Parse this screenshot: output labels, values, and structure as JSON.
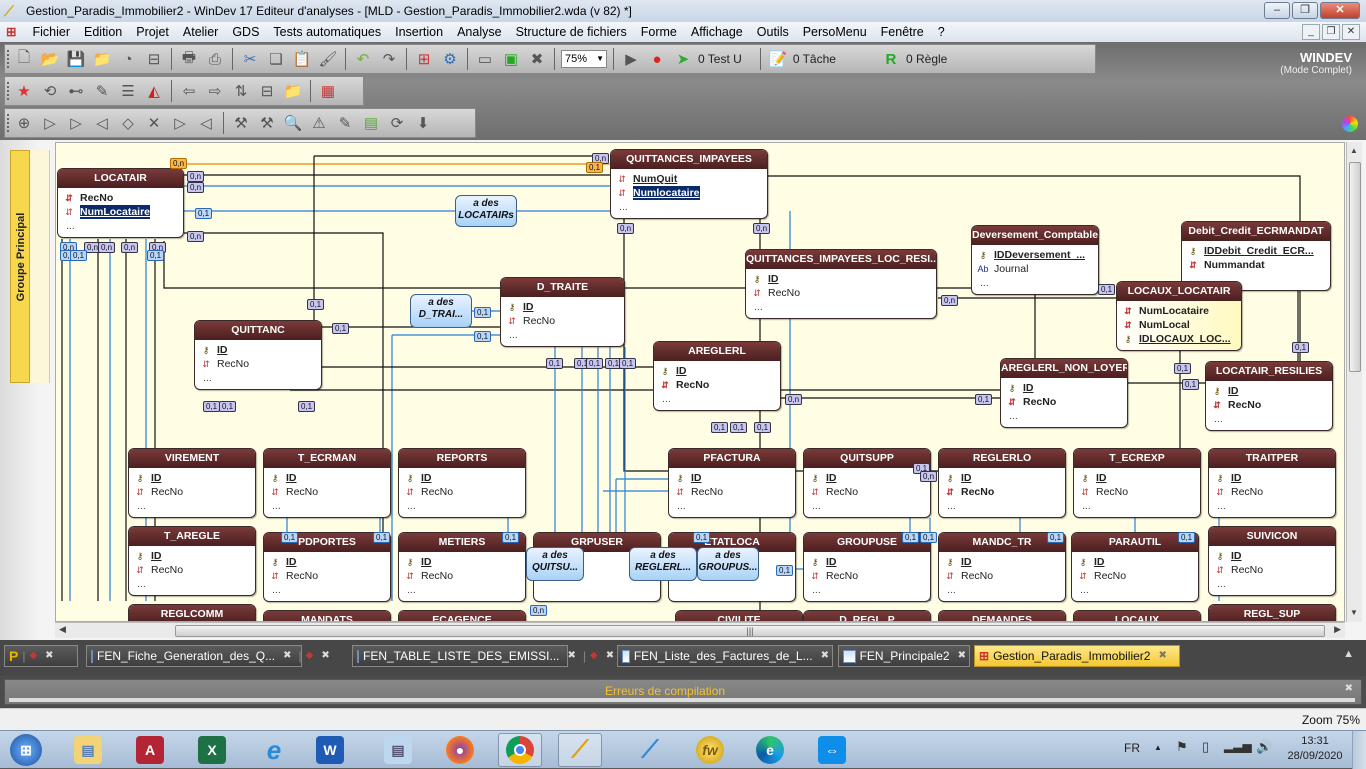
{
  "window": {
    "title": "Gestion_Paradis_Immobilier2 - WinDev 17  Editeur d'analyses - [MLD - Gestion_Paradis_Immobilier2.wda (v 82) *]",
    "minimize": "–",
    "maximize": "❐",
    "close": "✕"
  },
  "menu": {
    "items": [
      "Fichier",
      "Edition",
      "Projet",
      "Atelier",
      "GDS",
      "Tests automatiques",
      "Insertion",
      "Analyse",
      "Structure de fichiers",
      "Forme",
      "Affichage",
      "Outils",
      "PersoMenu",
      "Fenêtre",
      "?"
    ],
    "mdi": [
      "_",
      "❐",
      "✕"
    ]
  },
  "toolbar": {
    "zoom_value": "75%",
    "test_label": "0 Test U",
    "task_label": "0 Tâche",
    "rule_label": "0 Règle"
  },
  "brand": {
    "logo": "WINDEV",
    "mode": "(Mode Complet)"
  },
  "group": {
    "label": "Groupe Principal"
  },
  "tables": [
    {
      "id": "LOCATAIR",
      "title": "LOCATAIR",
      "fields": [
        {
          "icon": "index",
          "name": "RecNo",
          "style": "bold"
        },
        {
          "icon": "index",
          "name": "NumLocataire",
          "style": "sel"
        }
      ]
    },
    {
      "id": "QUITTANCES_IMPAYEES",
      "title": "QUITTANCES_IMPAYEES",
      "fields": [
        {
          "icon": "index",
          "name": "NumQuit",
          "style": "ul"
        },
        {
          "icon": "index",
          "name": "Numlocataire",
          "style": "sel"
        }
      ]
    },
    {
      "id": "QUITTANC",
      "title": "QUITTANC",
      "fields": [
        {
          "icon": "key",
          "name": "ID",
          "style": "ul"
        },
        {
          "icon": "index",
          "name": "RecNo",
          "style": ""
        }
      ]
    },
    {
      "id": "D_TRAITE",
      "title": "D_TRAITE",
      "fields": [
        {
          "icon": "key",
          "name": "ID",
          "style": "ul"
        },
        {
          "icon": "index",
          "name": "RecNo",
          "style": ""
        }
      ]
    },
    {
      "id": "QUITTANCES_IMPAYEES_LOC_RESI",
      "title": "QUITTANCES_IMPAYEES_LOC_RESI...",
      "fields": [
        {
          "icon": "key",
          "name": "ID",
          "style": "ul"
        },
        {
          "icon": "index",
          "name": "RecNo",
          "style": ""
        }
      ]
    },
    {
      "id": "AREGLERL",
      "title": "AREGLERL",
      "fields": [
        {
          "icon": "key",
          "name": "ID",
          "style": "ul"
        },
        {
          "icon": "index",
          "name": "RecNo",
          "style": "bold"
        }
      ]
    },
    {
      "id": "Deversement_Comptable",
      "title": "Deversement_Comptable",
      "fields": [
        {
          "icon": "key",
          "name": "IDDeversement_...",
          "style": "ul"
        },
        {
          "icon": "text",
          "name": "Journal",
          "style": ""
        }
      ]
    },
    {
      "id": "Debit_Credit_ECRMANDAT",
      "title": "Debit_Credit_ECRMANDAT",
      "fields": [
        {
          "icon": "key",
          "name": "IDDebit_Credit_ECR...",
          "style": "ul"
        },
        {
          "icon": "index",
          "name": "Nummandat",
          "style": "bold"
        }
      ]
    },
    {
      "id": "LOCAUX_LOCATAIR",
      "title": "LOCAUX_LOCATAIR",
      "fields": [
        {
          "icon": "index",
          "name": "NumLocataire",
          "style": "bold"
        },
        {
          "icon": "index",
          "name": "NumLocal",
          "style": "bold"
        },
        {
          "icon": "key",
          "name": "IDLOCAUX_LOC...",
          "style": "ul"
        }
      ],
      "dots": false
    },
    {
      "id": "AREGLERL_NON_LOYER",
      "title": "AREGLERL_NON_LOYER",
      "fields": [
        {
          "icon": "key",
          "name": "ID",
          "style": "ul"
        },
        {
          "icon": "index",
          "name": "RecNo",
          "style": "bold"
        }
      ]
    },
    {
      "id": "LOCATAIR_RESILIES",
      "title": "LOCATAIR_RESILIES",
      "fields": [
        {
          "icon": "key",
          "name": "ID",
          "style": "ul"
        },
        {
          "icon": "index",
          "name": "RecNo",
          "style": "bold"
        }
      ]
    },
    {
      "id": "VIREMENT",
      "title": "VIREMENT",
      "fields": [
        {
          "icon": "key",
          "name": "ID",
          "style": "ul"
        },
        {
          "icon": "index",
          "name": "RecNo",
          "style": ""
        }
      ]
    },
    {
      "id": "T_ECRMAN",
      "title": "T_ECRMAN",
      "fields": [
        {
          "icon": "key",
          "name": "ID",
          "style": "ul"
        },
        {
          "icon": "index",
          "name": "RecNo",
          "style": ""
        }
      ]
    },
    {
      "id": "REPORTS",
      "title": "REPORTS",
      "fields": [
        {
          "icon": "key",
          "name": "ID",
          "style": "ul"
        },
        {
          "icon": "index",
          "name": "RecNo",
          "style": ""
        }
      ]
    },
    {
      "id": "PFACTURA",
      "title": "PFACTURA",
      "fields": [
        {
          "icon": "key",
          "name": "ID",
          "style": "ul"
        },
        {
          "icon": "index",
          "name": "RecNo",
          "style": ""
        }
      ]
    },
    {
      "id": "QUITSUPP",
      "title": "QUITSUPP",
      "fields": [
        {
          "icon": "key",
          "name": "ID",
          "style": "ul"
        },
        {
          "icon": "index",
          "name": "RecNo",
          "style": ""
        }
      ]
    },
    {
      "id": "REGLERLO",
      "title": "REGLERLO",
      "fields": [
        {
          "icon": "key",
          "name": "ID",
          "style": "ul"
        },
        {
          "icon": "index",
          "name": "RecNo",
          "style": "bold"
        }
      ]
    },
    {
      "id": "T_ECREXP",
      "title": "T_ECREXP",
      "fields": [
        {
          "icon": "key",
          "name": "ID",
          "style": "ul"
        },
        {
          "icon": "index",
          "name": "RecNo",
          "style": ""
        }
      ]
    },
    {
      "id": "TRAITPER",
      "title": "TRAITPER",
      "fields": [
        {
          "icon": "key",
          "name": "ID",
          "style": "ul"
        },
        {
          "icon": "index",
          "name": "RecNo",
          "style": ""
        }
      ]
    },
    {
      "id": "T_AREGLE",
      "title": "T_AREGLE",
      "fields": [
        {
          "icon": "key",
          "name": "ID",
          "style": "ul"
        },
        {
          "icon": "index",
          "name": "RecNo",
          "style": ""
        }
      ]
    },
    {
      "id": "PDPORTES",
      "title": "PDPORTES",
      "fields": [
        {
          "icon": "key",
          "name": "ID",
          "style": "ul"
        },
        {
          "icon": "index",
          "name": "RecNo",
          "style": ""
        }
      ]
    },
    {
      "id": "METIERS",
      "title": "METIERS",
      "fields": [
        {
          "icon": "key",
          "name": "ID",
          "style": "ul"
        },
        {
          "icon": "index",
          "name": "RecNo",
          "style": ""
        }
      ]
    },
    {
      "id": "GRPUSER",
      "title": "GRPUSER",
      "fields": []
    },
    {
      "id": "ETATLOCA",
      "title": "ETATLOCA",
      "fields": []
    },
    {
      "id": "GROUPUSE",
      "title": "GROUPUSE",
      "fields": [
        {
          "icon": "key",
          "name": "ID",
          "style": "ul"
        },
        {
          "icon": "index",
          "name": "RecNo",
          "style": ""
        }
      ]
    },
    {
      "id": "MANDC_TR",
      "title": "MANDC_TR",
      "fields": [
        {
          "icon": "key",
          "name": "ID",
          "style": "ul"
        },
        {
          "icon": "index",
          "name": "RecNo",
          "style": ""
        }
      ]
    },
    {
      "id": "PARAUTIL",
      "title": "PARAUTIL",
      "fields": [
        {
          "icon": "key",
          "name": "ID",
          "style": "ul"
        },
        {
          "icon": "index",
          "name": "RecNo",
          "style": ""
        }
      ]
    },
    {
      "id": "SUIVICON",
      "title": "SUIVICON",
      "fields": [
        {
          "icon": "key",
          "name": "ID",
          "style": "ul"
        },
        {
          "icon": "index",
          "name": "RecNo",
          "style": ""
        }
      ]
    },
    {
      "id": "REGLCOMM",
      "title": "REGLCOMM",
      "fields": []
    },
    {
      "id": "MANDATS",
      "title": "MANDATS",
      "fields": []
    },
    {
      "id": "ECAGENCE",
      "title": "ECAGENCE",
      "fields": []
    },
    {
      "id": "CIVILITE",
      "title": "CIVILITE",
      "fields": []
    },
    {
      "id": "D_REGL_P",
      "title": "D_REGL_P",
      "fields": []
    },
    {
      "id": "DEMANDES",
      "title": "DEMANDES",
      "fields": []
    },
    {
      "id": "LOCAUX",
      "title": "LOCAUX",
      "fields": []
    },
    {
      "id": "REGL_SUP",
      "title": "REGL_SUP",
      "fields": []
    }
  ],
  "relations": [
    {
      "line1": "a des",
      "line2": "LOCATAIRs"
    },
    {
      "line1": "a des",
      "line2": "D_TRAI..."
    },
    {
      "line1": "a des",
      "line2": "QUITSU..."
    },
    {
      "line1": "a des",
      "line2": "REGLERL..."
    },
    {
      "line1": "a des",
      "line2": "GROUPUS..."
    }
  ],
  "cardinalities": {
    "zero_n": "0,n",
    "zero_one": "0,1"
  },
  "field_more": "...",
  "doc_tabs": [
    {
      "label": "",
      "kind": "project"
    },
    {
      "label": "",
      "kind": "icon"
    },
    {
      "label": "FEN_Fiche_Generation_des_Q...",
      "kind": "window"
    },
    {
      "label": "",
      "kind": "icon"
    },
    {
      "label": "FEN_TABLE_LISTE_DES_EMISSI...",
      "kind": "window"
    },
    {
      "label": "",
      "kind": "icon"
    },
    {
      "label": "FEN_Liste_des_Factures_de_L...",
      "kind": "window"
    },
    {
      "label": "FEN_Principale2",
      "kind": "window"
    },
    {
      "label": "Gestion_Paradis_Immobilier2",
      "kind": "analysis",
      "active": true
    }
  ],
  "panel": {
    "title": "Erreurs de compilation"
  },
  "status": {
    "zoom": "Zoom 75%"
  },
  "taskbar": {
    "apps": [
      "Démarrer",
      "Explorateur",
      "Access",
      "Excel",
      "Internet Explorer",
      "Word",
      "Bloc-notes",
      "Firefox",
      "Chrome",
      "WinDev",
      "WebDev",
      "WinDev Mobile",
      "Edge",
      "TeamViewer"
    ],
    "lang": "FR",
    "time": "13:31",
    "date": "28/09/2020"
  }
}
